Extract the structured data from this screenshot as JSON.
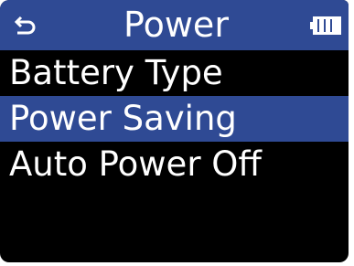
{
  "header": {
    "title": "Power",
    "back_icon": "return-arrow-icon",
    "battery_icon": "battery-icon",
    "battery_level": 1.0
  },
  "menu": {
    "items": [
      {
        "label": "Battery Type",
        "selected": false
      },
      {
        "label": "Power Saving",
        "selected": true
      },
      {
        "label": "Auto Power Off",
        "selected": false
      }
    ]
  },
  "colors": {
    "background": "#000000",
    "accent": "#2f4a94",
    "text": "#ffffff"
  }
}
